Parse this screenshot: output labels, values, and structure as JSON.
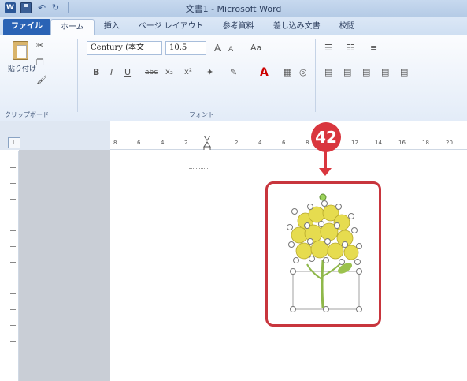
{
  "window": {
    "app_title": "文書1 - Microsoft Word",
    "word_icon": "W"
  },
  "tabs": [
    {
      "label": "ファイル"
    },
    {
      "label": "ホーム"
    },
    {
      "label": "挿入"
    },
    {
      "label": "ページ レイアウト"
    },
    {
      "label": "参考資料"
    },
    {
      "label": "差し込み文書"
    },
    {
      "label": "校閲"
    }
  ],
  "ribbon": {
    "paste_label": "貼り付け",
    "clipboard_group": "クリップボード",
    "font_group": "フォント",
    "font_name": "Century (本文",
    "font_size": "10.5",
    "grow_font": "A",
    "shrink_font": "A",
    "change_case": "Aa",
    "bold": "B",
    "italic": "I",
    "underline": "U",
    "strikethrough": "abc",
    "subscript": "x₂",
    "superscript": "x²",
    "font_color": "A"
  },
  "ruler": {
    "corner": "L",
    "ticks": [
      "8",
      "6",
      "4",
      "2",
      "2",
      "4",
      "6",
      "8",
      "10",
      "12",
      "14",
      "16",
      "18",
      "20"
    ]
  },
  "annotation": {
    "step_number": "42",
    "accent_color": "#d9363e"
  },
  "icons": [
    "word-icon",
    "save-icon",
    "undo-icon",
    "redo-icon",
    "paste-icon",
    "cut-icon",
    "copy-icon",
    "format-painter-icon",
    "highlighter-icon",
    "flower-clipart"
  ]
}
